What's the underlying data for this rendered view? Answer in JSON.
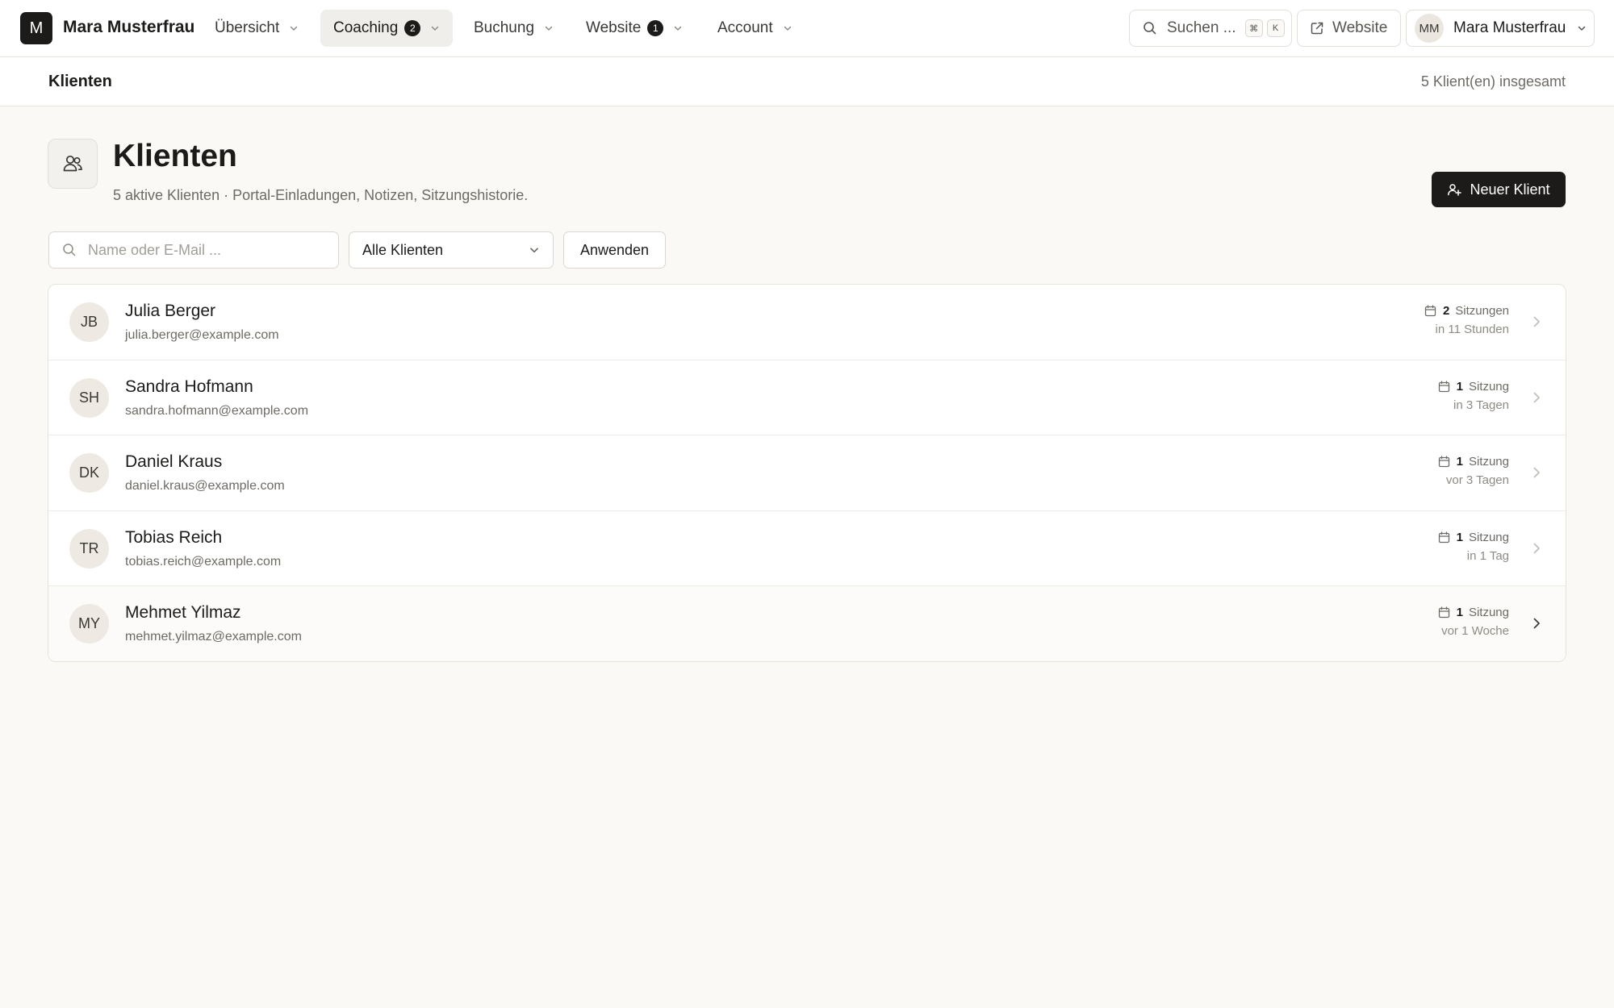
{
  "brand": {
    "logo_letter": "M",
    "name": "Mara Musterfrau"
  },
  "nav": [
    {
      "label": "Übersicht",
      "badge": ""
    },
    {
      "label": "Coaching",
      "badge": "2"
    },
    {
      "label": "Buchung",
      "badge": ""
    },
    {
      "label": "Website",
      "badge": "1"
    },
    {
      "label": "Account",
      "badge": ""
    }
  ],
  "topbar": {
    "search_label": "Suchen ...",
    "shortcut_mod": "⌘",
    "shortcut_key": "K",
    "website_label": "Website",
    "user_initials": "MM",
    "user_name": "Mara Musterfrau"
  },
  "subheader": {
    "breadcrumb": "Klienten",
    "total": "5 Klient(en) insgesamt"
  },
  "page": {
    "title": "Klienten",
    "subtitle": "5 aktive Klienten · Portal-Einladungen, Notizen, Sitzungshistorie.",
    "new_client_label": "Neuer Klient"
  },
  "filters": {
    "search_placeholder": "Name oder E-Mail ...",
    "select_value": "Alle Klienten",
    "apply_label": "Anwenden"
  },
  "clients": [
    {
      "initials": "JB",
      "name": "Julia Berger",
      "email": "julia.berger@example.com",
      "count": "2",
      "unit": "Sitzungen",
      "when": "in 11 Stunden"
    },
    {
      "initials": "SH",
      "name": "Sandra Hofmann",
      "email": "sandra.hofmann@example.com",
      "count": "1",
      "unit": "Sitzung",
      "when": "in 3 Tagen"
    },
    {
      "initials": "DK",
      "name": "Daniel Kraus",
      "email": "daniel.kraus@example.com",
      "count": "1",
      "unit": "Sitzung",
      "when": "vor 3 Tagen"
    },
    {
      "initials": "TR",
      "name": "Tobias Reich",
      "email": "tobias.reich@example.com",
      "count": "1",
      "unit": "Sitzung",
      "when": "in 1 Tag"
    },
    {
      "initials": "MY",
      "name": "Mehmet Yilmaz",
      "email": "mehmet.yilmaz@example.com",
      "count": "1",
      "unit": "Sitzung",
      "when": "vor 1 Woche"
    }
  ]
}
